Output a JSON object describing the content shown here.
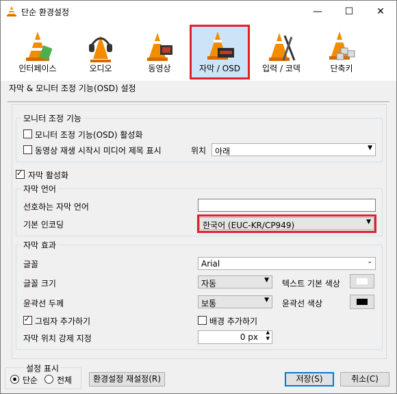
{
  "window": {
    "title": "단순 환경설정",
    "minimize": "—",
    "maximize": "☐",
    "close": "✕"
  },
  "toolbar": {
    "items": [
      {
        "label": "인터페이스"
      },
      {
        "label": "오디오"
      },
      {
        "label": "동영상"
      },
      {
        "label": "자막 / OSD",
        "selected": true
      },
      {
        "label": "입력 / 코덱"
      },
      {
        "label": "단축키"
      }
    ]
  },
  "page_title": "자막 & 모니터 조정 기능(OSD) 설정",
  "osd_group": {
    "legend": "모니터 조정 기능",
    "enable_osd": {
      "label": "모니터 조정 기능(OSD) 활성화",
      "checked": false
    },
    "show_title": {
      "label": "동영상 재생 시작시 미디어 제목 표시",
      "checked": false
    },
    "position_label": "위치",
    "position_value": "아래"
  },
  "enable_subtitles": {
    "label": "자막 활성화",
    "checked": true
  },
  "lang_group": {
    "legend": "자막 언어",
    "preferred_label": "선호하는 자막 언어",
    "preferred_value": "",
    "encoding_label": "기본 인코딩",
    "encoding_value": "한국어 (EUC-KR/CP949)"
  },
  "effects_group": {
    "legend": "자막 효과",
    "font_label": "글꼴",
    "font_value": "Arial",
    "size_label": "글꼴 크기",
    "size_value": "자동",
    "text_color_label": "텍스트 기본 색상",
    "text_color": "#ffffff",
    "outline_label": "윤곽선 두께",
    "outline_value": "보통",
    "outline_color_label": "윤곽선 색상",
    "outline_color": "#000000",
    "shadow": {
      "label": "그림자 추가하기",
      "checked": true
    },
    "background": {
      "label": "배경 추가하기",
      "checked": false
    },
    "force_pos_label": "자막 위치 강제 지정",
    "force_pos_value": "0 px"
  },
  "footer": {
    "legend": "설정 표시",
    "simple_label": "단순",
    "all_label": "전체",
    "reset_label": "환경설정 재설정(R)",
    "save_label": "저장(S)",
    "cancel_label": "취소(C)"
  },
  "colors": {
    "accent_highlight": "#e0202a",
    "selection_bg": "#cce4f7"
  }
}
